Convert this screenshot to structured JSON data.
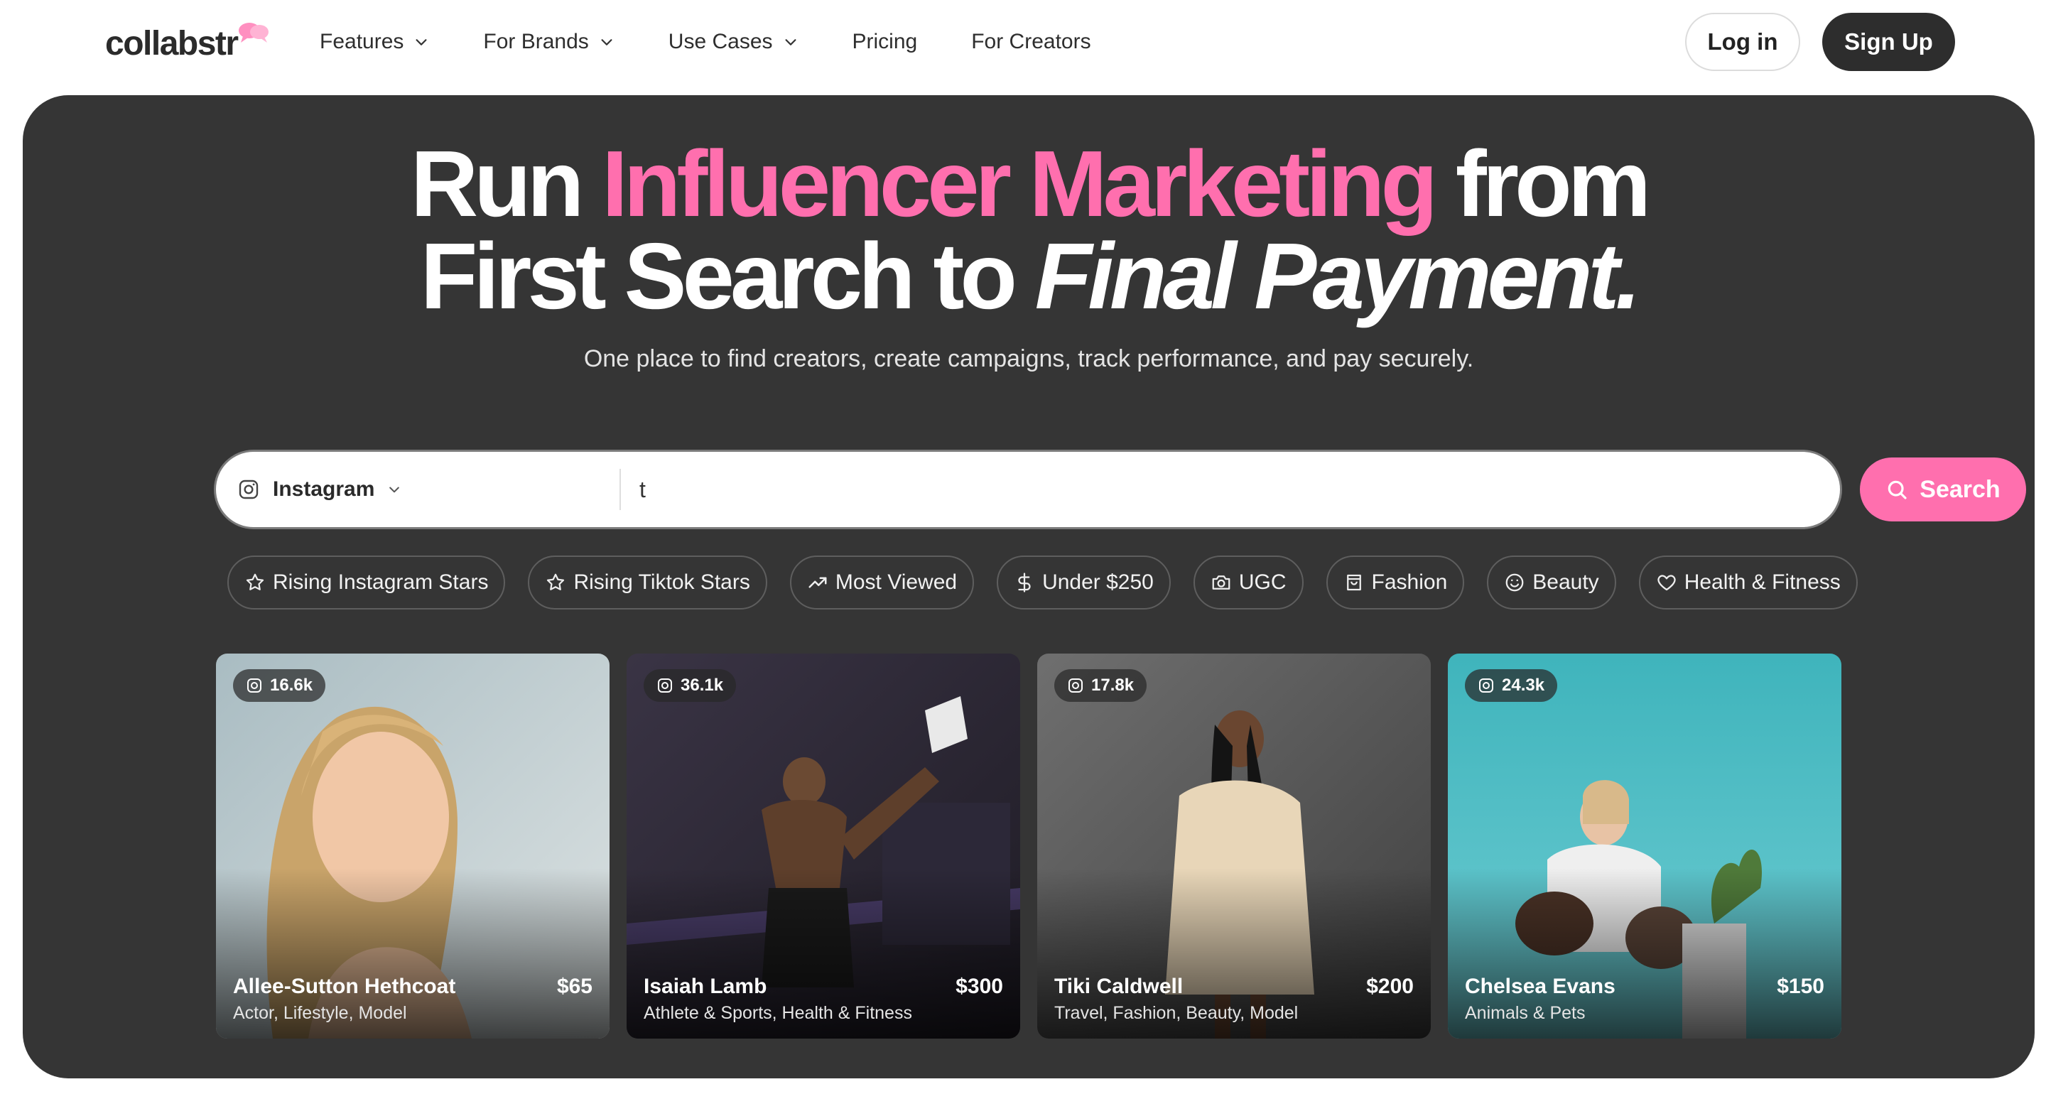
{
  "nav": {
    "logo": "collabstr",
    "links": [
      {
        "label": "Features",
        "dropdown": true
      },
      {
        "label": "For Brands",
        "dropdown": true
      },
      {
        "label": "Use Cases",
        "dropdown": true
      },
      {
        "label": "Pricing",
        "dropdown": false
      },
      {
        "label": "For Creators",
        "dropdown": false
      }
    ],
    "login": "Log in",
    "signup": "Sign Up"
  },
  "hero": {
    "line1_a": "Run ",
    "line1_pink": "Influencer Marketing",
    "line1_b": " from",
    "line2_a": "First Search to ",
    "line2_italic": "Final Payment.",
    "subtitle": "One place to find creators, create campaigns, track performance, and pay securely."
  },
  "search": {
    "platform": "Instagram",
    "value": "t",
    "button": "Search"
  },
  "chips": [
    {
      "label": "Rising Instagram Stars",
      "icon": "star-icon"
    },
    {
      "label": "Rising Tiktok Stars",
      "icon": "star-icon"
    },
    {
      "label": "Most Viewed",
      "icon": "trending-icon"
    },
    {
      "label": "Under $250",
      "icon": "dollar-icon"
    },
    {
      "label": "UGC",
      "icon": "camera-icon"
    },
    {
      "label": "Fashion",
      "icon": "shopping-bag-icon"
    },
    {
      "label": "Beauty",
      "icon": "smile-icon"
    },
    {
      "label": "Health & Fitness",
      "icon": "heart-icon"
    }
  ],
  "creators": [
    {
      "followers": "16.6k",
      "name": "Allee-Sutton Hethcoat",
      "price": "$65",
      "tags": "Actor, Lifestyle, Model"
    },
    {
      "followers": "36.1k",
      "name": "Isaiah Lamb",
      "price": "$300",
      "tags": "Athlete & Sports, Health & Fitness"
    },
    {
      "followers": "17.8k",
      "name": "Tiki Caldwell",
      "price": "$200",
      "tags": "Travel, Fashion, Beauty, Model"
    },
    {
      "followers": "24.3k",
      "name": "Chelsea Evans",
      "price": "$150",
      "tags": "Animals & Pets"
    }
  ],
  "colors": {
    "accent_pink": "#ff6fae",
    "hero_bg": "#353535",
    "dark_button": "#2d2d2d"
  }
}
